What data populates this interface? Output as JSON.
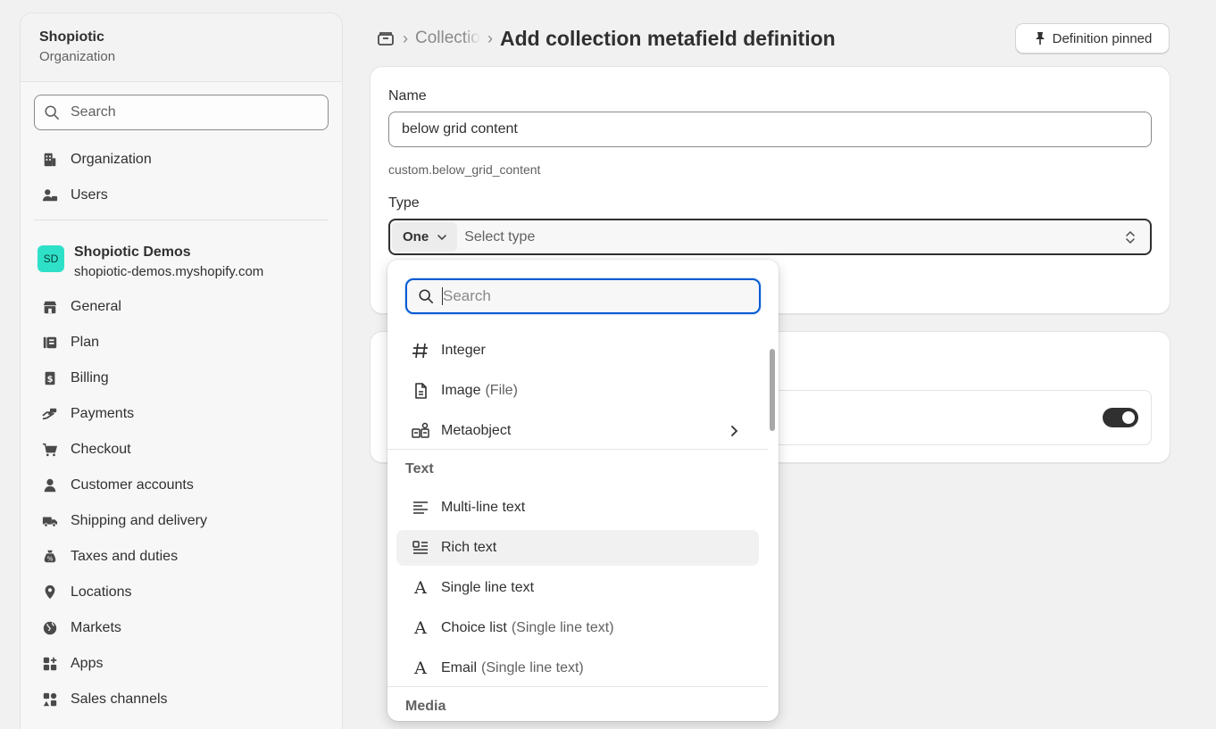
{
  "sidebar": {
    "org_name": "Shopiotic",
    "org_sub": "Organization",
    "search_placeholder": "Search",
    "top_items": [
      {
        "label": "Organization",
        "icon": "building-icon"
      },
      {
        "label": "Users",
        "icon": "users-icon"
      }
    ],
    "store": {
      "badge": "SD",
      "name": "Shopiotic Demos",
      "domain": "shopiotic-demos.myshopify.com"
    },
    "items": [
      {
        "label": "General",
        "icon": "store-icon"
      },
      {
        "label": "Plan",
        "icon": "plan-icon"
      },
      {
        "label": "Billing",
        "icon": "billing-icon"
      },
      {
        "label": "Payments",
        "icon": "payments-icon"
      },
      {
        "label": "Checkout",
        "icon": "cart-icon"
      },
      {
        "label": "Customer accounts",
        "icon": "person-icon"
      },
      {
        "label": "Shipping and delivery",
        "icon": "truck-icon"
      },
      {
        "label": "Taxes and duties",
        "icon": "tax-icon"
      },
      {
        "label": "Locations",
        "icon": "location-icon"
      },
      {
        "label": "Markets",
        "icon": "globe-icon"
      },
      {
        "label": "Apps",
        "icon": "apps-icon"
      },
      {
        "label": "Sales channels",
        "icon": "sales-channels-icon"
      }
    ]
  },
  "header": {
    "crumb": "Collections",
    "title": "Add collection metafield definition",
    "pinned_label": "Definition pinned"
  },
  "form": {
    "name_label": "Name",
    "name_value": "below grid content",
    "key_hint": "custom.below_grid_content",
    "type_label": "Type",
    "one_label": "One",
    "type_placeholder": "Select type"
  },
  "dropdown": {
    "search_placeholder": "Search",
    "options_top": [
      {
        "label": "Integer",
        "sub": "",
        "icon": "hash-icon"
      },
      {
        "label": "Image",
        "sub": "(File)",
        "icon": "file-icon"
      },
      {
        "label": "Metaobject",
        "sub": "",
        "icon": "metaobject-icon"
      }
    ],
    "section_text": "Text",
    "options_text": [
      {
        "label": "Multi-line text",
        "sub": "",
        "icon": "multiline-text-icon"
      },
      {
        "label": "Rich text",
        "sub": "",
        "icon": "rich-text-icon"
      },
      {
        "label": "Single line text",
        "sub": "",
        "icon": "letter-a-icon"
      },
      {
        "label": "Choice list",
        "sub": "(Single line text)",
        "icon": "letter-a-icon"
      },
      {
        "label": "Email",
        "sub": "(Single line text)",
        "icon": "letter-a-icon"
      }
    ],
    "section_media": "Media"
  },
  "colors": {
    "accent_focus": "#005bd3",
    "store_badge": "#2ee0c8",
    "toggle_on": "#303030"
  }
}
